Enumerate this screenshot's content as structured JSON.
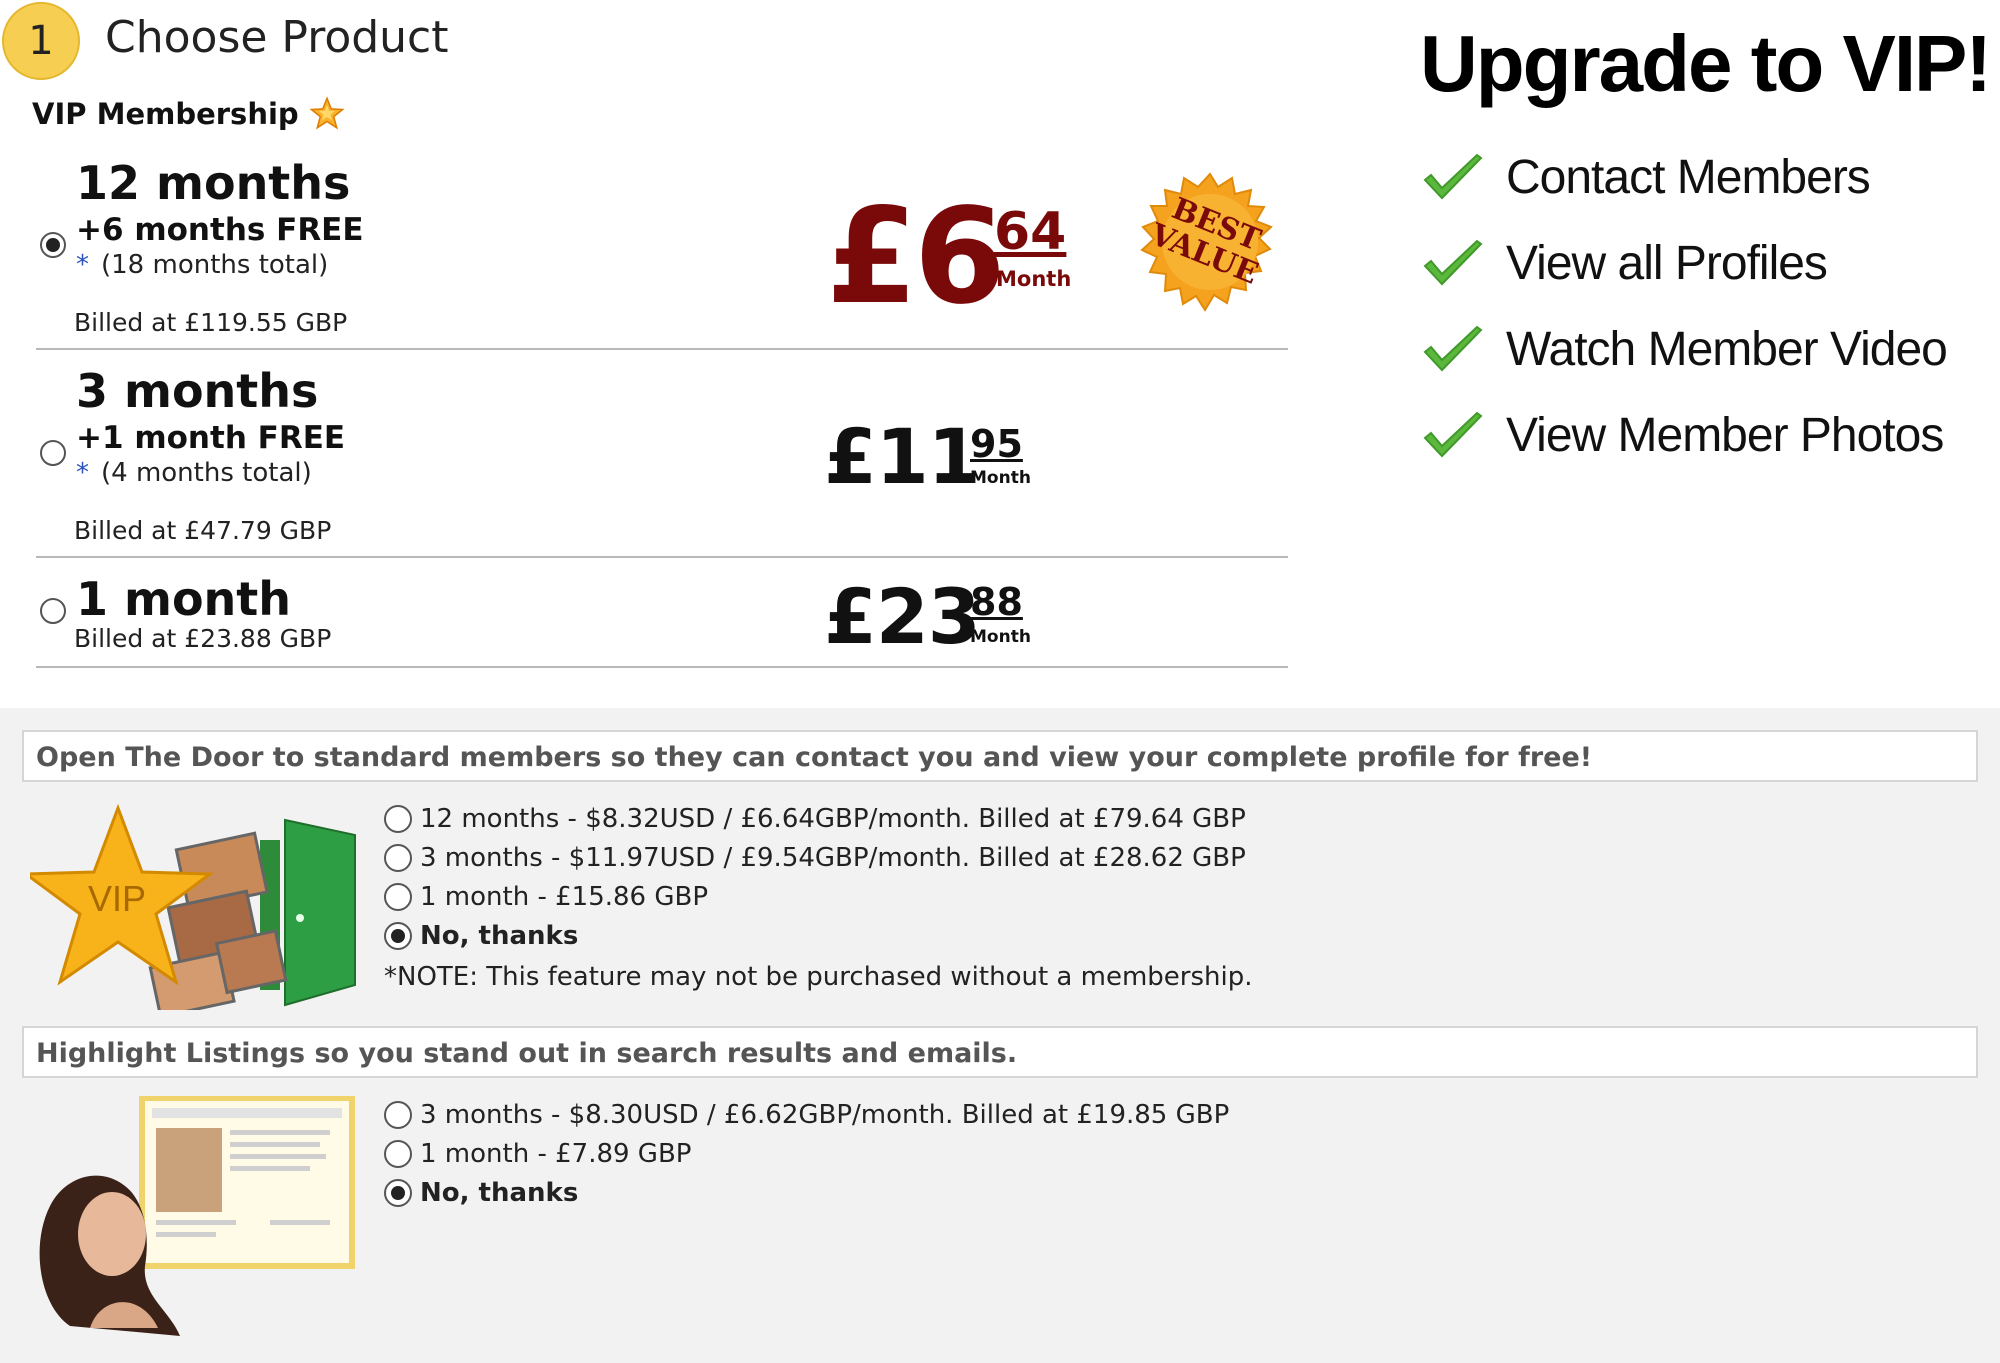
{
  "header": {
    "step_number": "1",
    "step_title": "Choose Product",
    "vip_membership_label": "VIP Membership"
  },
  "plans": [
    {
      "title": "12 months",
      "free": "+6 months FREE",
      "total_asterisk": "*",
      "total": "(18 months total)",
      "billed": "Billed at £119.55 GBP",
      "price_whole": "£6",
      "price_cents": "64",
      "price_unit": "Month",
      "selected": true,
      "badge": "BEST VALUE"
    },
    {
      "title": "3 months",
      "free": "+1 month FREE",
      "total_asterisk": "*",
      "total": "(4 months total)",
      "billed": "Billed at £47.79 GBP",
      "price_whole": "£11",
      "price_cents": "95",
      "price_unit": "Month",
      "selected": false
    },
    {
      "title": "1 month",
      "billed": "Billed at £23.88 GBP",
      "price_whole": "£23",
      "price_cents": "88",
      "price_unit": "Month",
      "selected": false
    }
  ],
  "upgrade": {
    "title": "Upgrade to VIP!",
    "benefits": [
      "Contact Members",
      "View all Profiles",
      "Watch Member Video",
      "View Member Photos"
    ],
    "check_icon_color": "#5cb83c"
  },
  "open_door": {
    "heading": "Open The Door to standard members so they can contact you and view your complete profile for free!",
    "image_label": "VIP",
    "options": [
      {
        "label": "12 months - $8.32USD / £6.64GBP/month. Billed at £79.64 GBP",
        "selected": false
      },
      {
        "label": "3 months - $11.97USD / £9.54GBP/month. Billed at £28.62 GBP",
        "selected": false
      },
      {
        "label": "1 month - £15.86 GBP",
        "selected": false
      },
      {
        "label": "No, thanks",
        "selected": true
      }
    ],
    "note": "*NOTE: This feature may not be purchased without a membership."
  },
  "highlight": {
    "heading": "Highlight Listings so you stand out in search results and emails.",
    "options": [
      {
        "label": "3 months - $8.30USD / £6.62GBP/month. Billed at £19.85 GBP",
        "selected": false
      },
      {
        "label": "1 month - £7.89 GBP",
        "selected": false
      },
      {
        "label": "No, thanks",
        "selected": true
      }
    ]
  },
  "colors": {
    "featured_price": "#7a0a0a",
    "badge": "#f5a21f",
    "step_badge": "#f6cf52",
    "addon_background": "#f2f2f2",
    "door_green": "#2e8b3a"
  }
}
